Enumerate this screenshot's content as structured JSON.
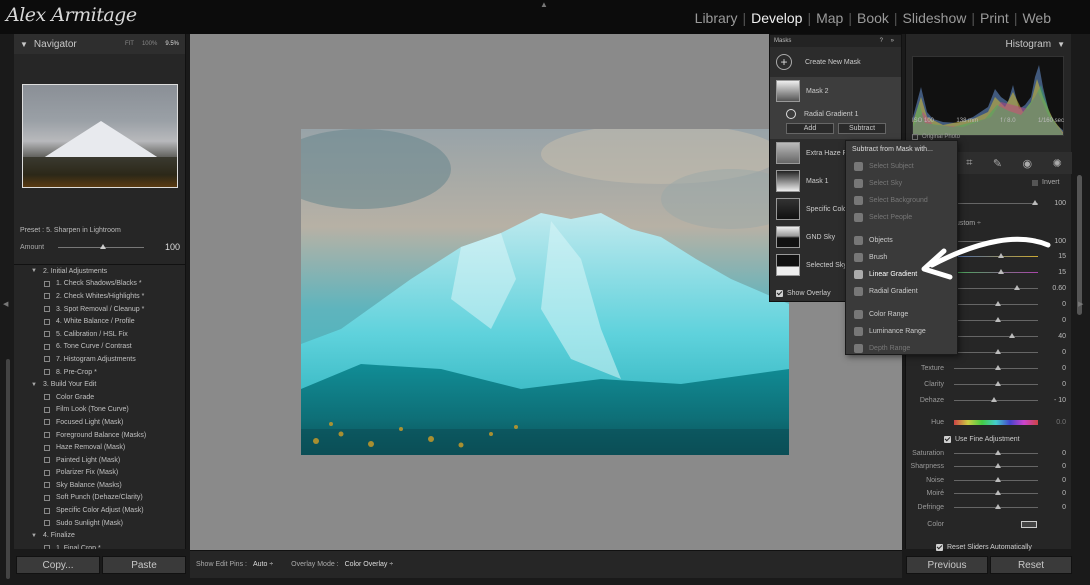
{
  "app": {
    "logo_text": "Alex Armitage",
    "modules": [
      "Library",
      "Develop",
      "Map",
      "Book",
      "Slideshow",
      "Print",
      "Web"
    ],
    "active_module": "Develop"
  },
  "navigator": {
    "title": "Navigator",
    "zoom_options": [
      "FIT",
      "100%",
      "9.5%"
    ],
    "preset_label": "Preset : 5. Sharpen in Lightroom",
    "amount_label": "Amount",
    "amount_value": "100"
  },
  "presets": [
    {
      "type": "group",
      "label": "2. Initial Adjustments"
    },
    {
      "type": "item",
      "label": "1. Check Shadows/Blacks *"
    },
    {
      "type": "item",
      "label": "2. Check Whites/Highlights *"
    },
    {
      "type": "item",
      "label": "3. Spot Removal / Cleanup *"
    },
    {
      "type": "item",
      "label": "4. White Balance / Profile"
    },
    {
      "type": "item",
      "label": "5. Calibration / HSL Fix"
    },
    {
      "type": "item",
      "label": "6. Tone Curve / Contrast"
    },
    {
      "type": "item",
      "label": "7. Histogram Adjustments"
    },
    {
      "type": "item",
      "label": "8. Pre-Crop *"
    },
    {
      "type": "group",
      "label": "3. Build Your Edit"
    },
    {
      "type": "item",
      "label": "Color Grade"
    },
    {
      "type": "item",
      "label": "Film Look (Tone Curve)"
    },
    {
      "type": "item",
      "label": "Focused Light (Mask)"
    },
    {
      "type": "item",
      "label": "Foreground Balance (Masks)"
    },
    {
      "type": "item",
      "label": "Haze Removal (Mask)"
    },
    {
      "type": "item",
      "label": "Painted Light (Mask)"
    },
    {
      "type": "item",
      "label": "Polarizer Fix (Mask)"
    },
    {
      "type": "item",
      "label": "Sky Balance (Masks)"
    },
    {
      "type": "item",
      "label": "Soft Punch (Dehaze/Clarity)"
    },
    {
      "type": "item",
      "label": "Specific Color Adjust (Mask)"
    },
    {
      "type": "item",
      "label": "Sudo Sunlight (Mask)"
    },
    {
      "type": "group",
      "label": "4. Finalize"
    },
    {
      "type": "item",
      "label": "1. Final Crop *"
    }
  ],
  "left_buttons": {
    "copy": "Copy...",
    "paste": "Paste"
  },
  "toolbar": {
    "edit_pins_label": "Show Edit Pins :",
    "edit_pins_value": "Auto ÷",
    "overlay_label": "Overlay Mode :",
    "overlay_value": "Color Overlay ÷"
  },
  "masks": {
    "title": "Masks",
    "header_icons": "? »",
    "create_label": "Create New Mask",
    "mask2_label": "Mask 2",
    "radial_label": "Radial Gradient 1",
    "add_label": "Add",
    "subtract_label": "Subtract",
    "list": [
      "Extra Haze Re",
      "Mask 1",
      "Specific Color",
      "GND Sky",
      "Selected Sky"
    ],
    "show_overlay": "Show Overlay"
  },
  "subtract_menu": {
    "title": "Subtract from Mask with...",
    "items": [
      {
        "label": "Select Subject",
        "state": "dim"
      },
      {
        "label": "Select Sky",
        "state": "dim"
      },
      {
        "label": "Select Background",
        "state": "dim"
      },
      {
        "label": "Select People",
        "state": "dim"
      },
      {
        "label": "sep"
      },
      {
        "label": "Objects",
        "state": "normal"
      },
      {
        "label": "Brush",
        "state": "normal"
      },
      {
        "label": "Linear Gradient",
        "state": "highlight"
      },
      {
        "label": "Radial Gradient",
        "state": "normal"
      },
      {
        "label": "sep"
      },
      {
        "label": "Color Range",
        "state": "normal"
      },
      {
        "label": "Luminance Range",
        "state": "normal"
      },
      {
        "label": "Depth Range",
        "state": "dim"
      }
    ]
  },
  "histogram": {
    "title": "Histogram",
    "iso": "ISO 100",
    "focal": "138 mm",
    "aperture": "f / 8.0",
    "shutter": "1/160 sec",
    "original_photo": "Original Photo"
  },
  "right_panel": {
    "custom_label": "ustom ÷",
    "invert_label": "Invert",
    "amount_value": "100",
    "sliders": [
      {
        "label": "",
        "value": "100"
      },
      {
        "label": "",
        "value": "15"
      },
      {
        "label": "",
        "value": "15"
      },
      {
        "label": "",
        "value": "0.60"
      },
      {
        "label": "",
        "value": "0"
      },
      {
        "label": "",
        "value": "0"
      },
      {
        "label": "",
        "value": "40"
      },
      {
        "label": "Blacks",
        "value": "0"
      },
      {
        "label": "Texture",
        "value": "0"
      },
      {
        "label": "Clarity",
        "value": "0"
      },
      {
        "label": "Dehaze",
        "value": "- 10"
      }
    ],
    "hue_label": "Hue",
    "hue_value": "0.0",
    "fine_adjust": "Use Fine Adjustment",
    "sliders2": [
      {
        "label": "Saturation",
        "value": "0"
      },
      {
        "label": "Sharpness",
        "value": "0"
      },
      {
        "label": "Noise",
        "value": "0"
      },
      {
        "label": "Moiré",
        "value": "0"
      },
      {
        "label": "Defringe",
        "value": "0"
      }
    ],
    "color_label": "Color",
    "reset_auto": "Reset Sliders Automatically"
  },
  "right_buttons": {
    "previous": "Previous",
    "reset": "Reset"
  }
}
